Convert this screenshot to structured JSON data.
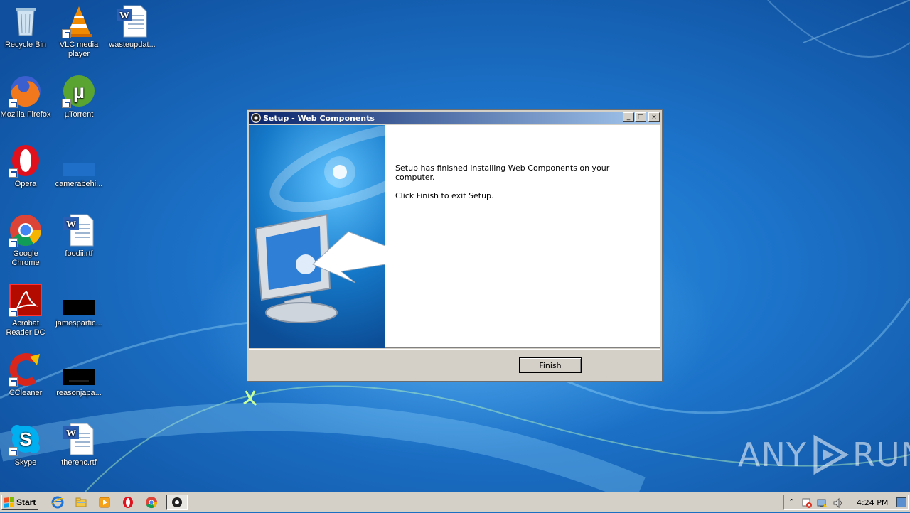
{
  "desktop": {
    "icons": [
      {
        "label": "Recycle Bin",
        "icon": "recycle-bin-icon"
      },
      {
        "label": "VLC media player",
        "icon": "vlc-icon"
      },
      {
        "label": "wasteupdat...",
        "icon": "word-document-icon"
      },
      {
        "label": "Mozilla Firefox",
        "icon": "firefox-icon"
      },
      {
        "label": "µTorrent",
        "icon": "utorrent-icon"
      },
      {
        "label": "Opera",
        "icon": "opera-icon"
      },
      {
        "label": "camerabehi...",
        "icon": "blank-file-icon"
      },
      {
        "label": "Google Chrome",
        "icon": "chrome-icon"
      },
      {
        "label": "foodii.rtf",
        "icon": "word-document-icon"
      },
      {
        "label": "Acrobat Reader DC",
        "icon": "acrobat-icon"
      },
      {
        "label": "jamespartic...",
        "icon": "black-file-icon"
      },
      {
        "label": "CCleaner",
        "icon": "ccleaner-icon"
      },
      {
        "label": "reasonjapa...",
        "icon": "black-file-icon"
      },
      {
        "label": "Skype",
        "icon": "skype-icon"
      },
      {
        "label": "therenc.rtf",
        "icon": "word-document-icon"
      }
    ]
  },
  "dialog": {
    "title": "Setup - Web Components",
    "message1": "Setup has finished installing Web Components on your computer.",
    "message2": "Click Finish to exit Setup.",
    "finish_label": "Finish",
    "minimize_glyph": "_",
    "maximize_glyph": "□",
    "close_glyph": "×"
  },
  "watermark": {
    "left": "ANY",
    "right": "RUN"
  },
  "taskbar": {
    "start_label": "Start",
    "clock": "4:24 PM",
    "quick_launch": [
      "ie-icon",
      "explorer-icon",
      "media-player-icon",
      "opera-icon",
      "chrome-icon"
    ],
    "active_task_icon": "setup-app-icon"
  },
  "colors": {
    "titlebar_start": "#0a246a",
    "titlebar_end": "#a6caf0",
    "desktop_blue": "#1c73c9"
  }
}
